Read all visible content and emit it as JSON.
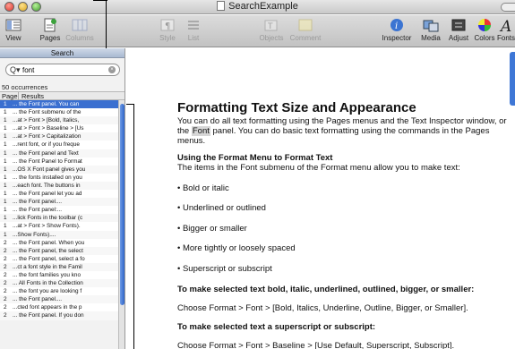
{
  "window": {
    "title": "SearchExample"
  },
  "toolbar": {
    "view": "View",
    "pages": "Pages",
    "columns": "Columns",
    "style": "Style",
    "list": "List",
    "objects": "Objects",
    "comment": "Comment",
    "inspector": "Inspector",
    "media": "Media",
    "adjust": "Adjust",
    "colors": "Colors",
    "fonts": "Fonts"
  },
  "search": {
    "title": "Search",
    "query": "font",
    "occurrences": "50 occurrences",
    "col_page": "Page",
    "col_results": "Results",
    "results": [
      {
        "page": "1",
        "text": "... the Font panel. You can"
      },
      {
        "page": "1",
        "text": "... the Font submenu of the"
      },
      {
        "page": "1",
        "text": "...at > Font > [Bold, Italics,"
      },
      {
        "page": "1",
        "text": "...at > Font > Baseline > [Us"
      },
      {
        "page": "1",
        "text": "...at > Font > Capitalization"
      },
      {
        "page": "1",
        "text": "...rent font, or if you freque"
      },
      {
        "page": "1",
        "text": "... the Font panel and Text"
      },
      {
        "page": "1",
        "text": "... the Font Panel to Format"
      },
      {
        "page": "1",
        "text": "...OS X Font panel gives you"
      },
      {
        "page": "1",
        "text": "... the fonts installed on you"
      },
      {
        "page": "1",
        "text": "...each font. The buttons in"
      },
      {
        "page": "1",
        "text": "... the Font panel let you ad"
      },
      {
        "page": "1",
        "text": "... the Font panel...."
      },
      {
        "page": "1",
        "text": "... the Font panel:..."
      },
      {
        "page": "1",
        "text": "...lick Fonts in the toolbar (c"
      },
      {
        "page": "1",
        "text": "...at > Font > Show Fonts)."
      },
      {
        "page": "1",
        "text": "...Show Fonts)...."
      },
      {
        "page": "2",
        "text": "... the Font panel. When you"
      },
      {
        "page": "2",
        "text": "... the Font panel, the select"
      },
      {
        "page": "2",
        "text": "... the Font panel, select a fo"
      },
      {
        "page": "2",
        "text": "...ct a font style in the Famil"
      },
      {
        "page": "2",
        "text": "... the font families you kno"
      },
      {
        "page": "2",
        "text": "... All Fonts in the Collection"
      },
      {
        "page": "2",
        "text": "... the font you are looking f"
      },
      {
        "page": "2",
        "text": "... the Font panel...."
      },
      {
        "page": "2",
        "text": "...cted font appears in the p"
      },
      {
        "page": "2",
        "text": "... the Font panel. If you don"
      }
    ]
  },
  "document": {
    "heading": "Formatting Text Size and Appearance",
    "intro_a": "You can do all text formatting using the Pages menus and the Text Inspector window, or the ",
    "intro_hl": "Font",
    "intro_b": " panel. You can do basic text formatting using the commands in the Pages menus.",
    "sub1": "Using the Format Menu to Format Text",
    "sub1_body": "The items in the Font submenu of the Format menu allow you to make text:",
    "bullets": [
      "• Bold or italic",
      "• Underlined or outlined",
      "• Bigger or smaller",
      "• More tightly or loosely spaced",
      "• Superscript or subscript"
    ],
    "sub2": "To make selected text bold, italic, underlined, outlined, bigger, or smaller:",
    "sub2_body": "Choose Format > Font > [Bold, Italics, Underline, Outline, Bigger, or Smaller].",
    "sub3": "To make selected text a superscript or subscript:",
    "sub3_body": "Choose Format > Font > Baseline > [Use Default, Superscript, Subscript]."
  }
}
